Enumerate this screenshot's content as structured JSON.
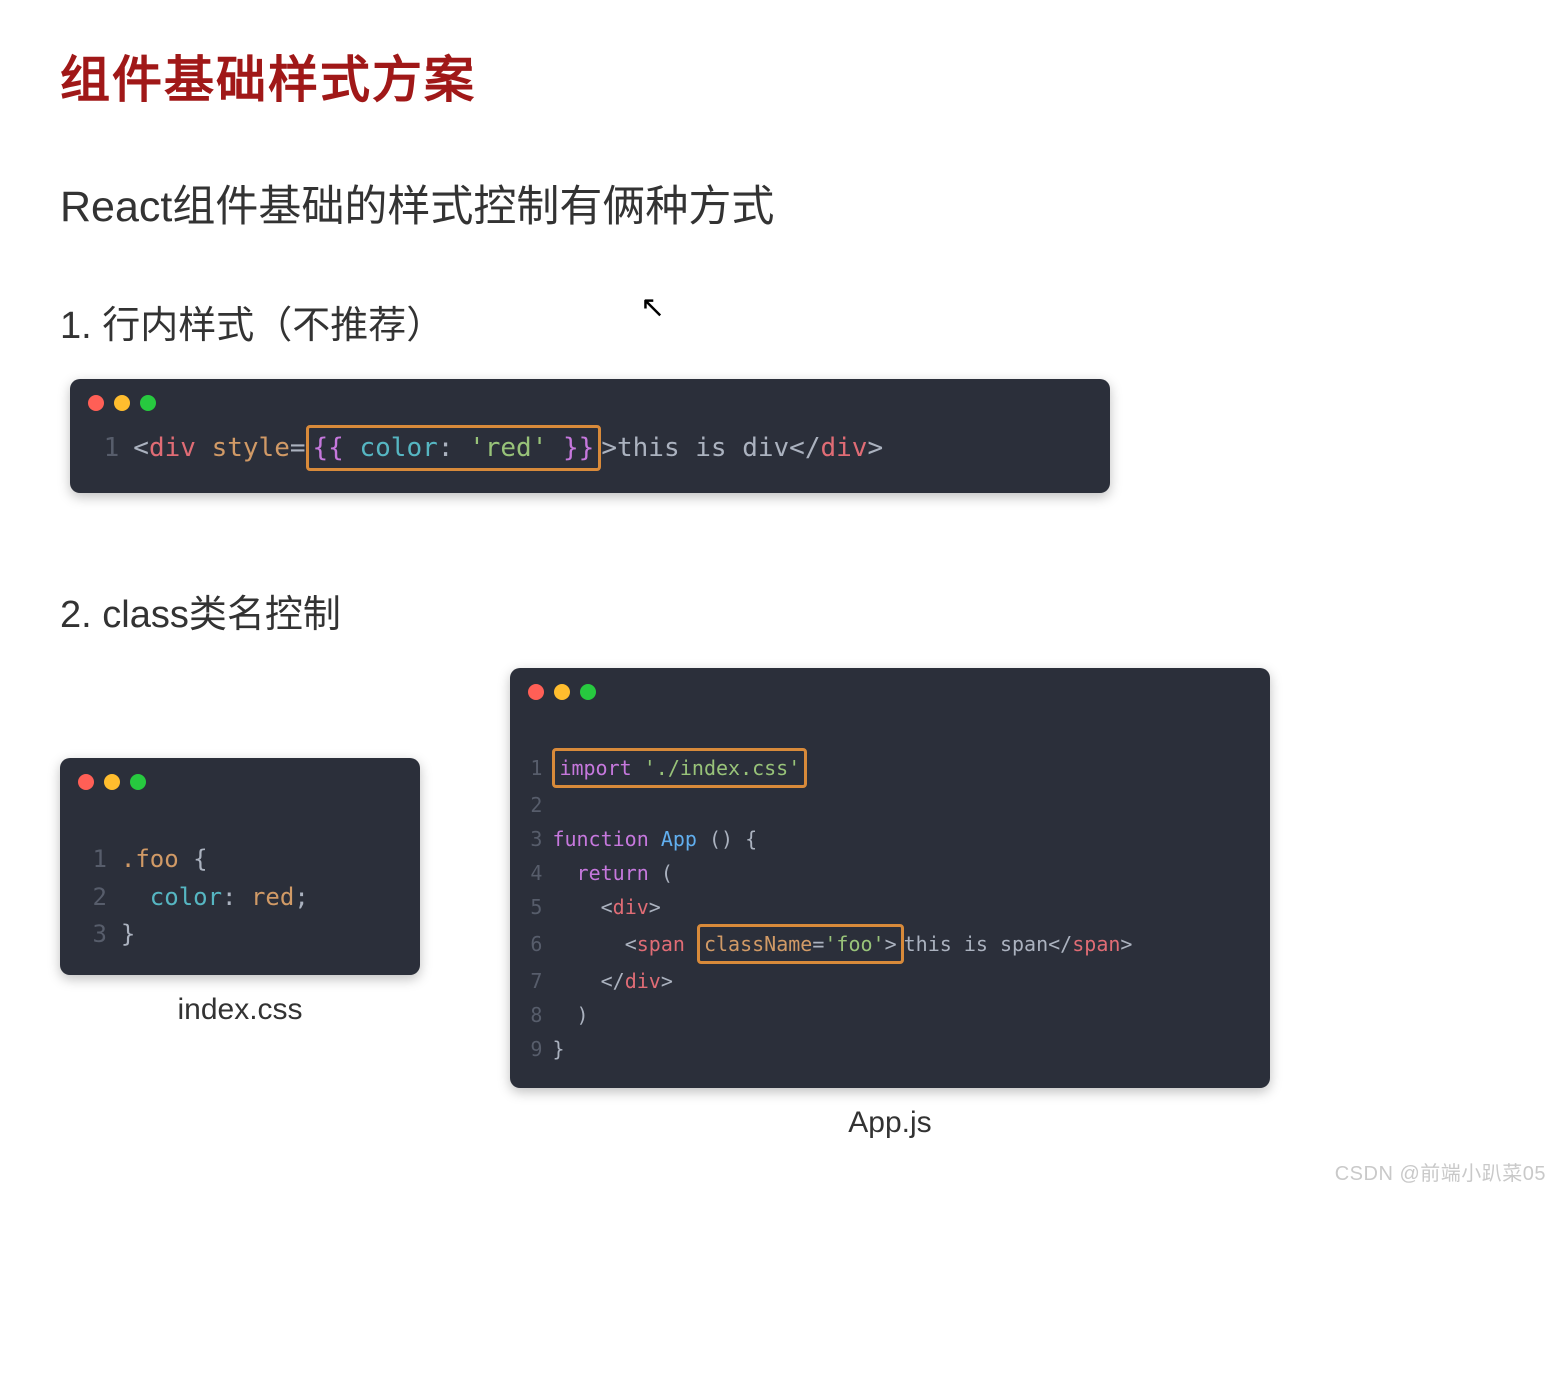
{
  "title": "组件基础样式方案",
  "subtitle": "React组件基础的样式控制有俩种方式",
  "section1": {
    "heading": "1. 行内样式（不推荐）"
  },
  "section2": {
    "heading": "2. class类名控制"
  },
  "code1": {
    "ln1": "1",
    "open_bracket": "<",
    "tag_div": "div",
    "attr_style": "style",
    "eq": "=",
    "hl_open": "{{ ",
    "key_color": "color",
    "colon": ": ",
    "val_red": "'red'",
    "hl_close": " }}",
    "gt": ">",
    "text": "this is div",
    "close_open": "</",
    "close_gt": ">"
  },
  "code2": {
    "ln1": "1",
    "ln2": "2",
    "ln3": "3",
    "sel": ".foo",
    "brace_open": " {",
    "prop": "color",
    "colon": ": ",
    "val": "red",
    "semi": ";",
    "brace_close": "}",
    "caption": "index.css"
  },
  "code3": {
    "ln1": "1",
    "ln2": "2",
    "ln3": "3",
    "ln4": "4",
    "ln5": "5",
    "ln6": "6",
    "ln7": "7",
    "ln8": "8",
    "ln9": "9",
    "kw_import": "import",
    "str_css": "'./index.css'",
    "kw_function": "function",
    "fn_app": "App",
    "parens": " () {",
    "kw_return": "return",
    "paren_open": " (",
    "lt": "<",
    "gt": ">",
    "slash_lt": "</",
    "tag_div": "div",
    "tag_span": "span",
    "space6": "      ",
    "attr_className": "className",
    "eq": "=",
    "val_foo": "'foo'",
    "text_span": "this is span",
    "paren_close": "  )",
    "brace_close": "}",
    "caption": "App.js"
  },
  "watermark": "CSDN @前端小趴菜05"
}
